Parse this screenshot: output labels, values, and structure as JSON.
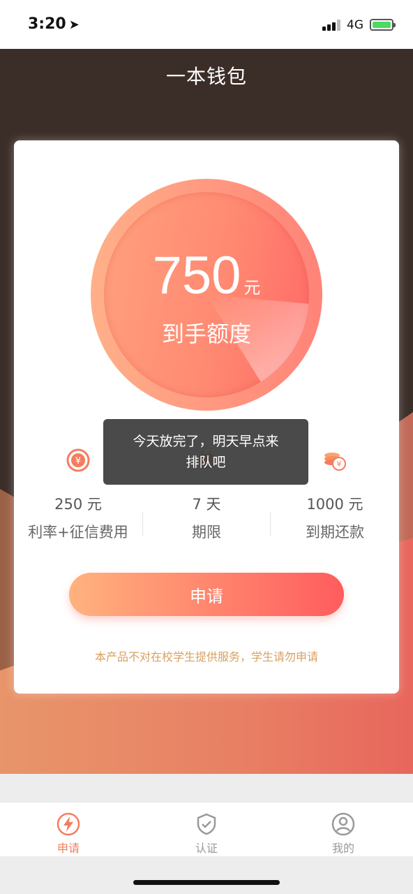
{
  "status": {
    "time": "3:20",
    "location_icon": "location-arrow-icon",
    "network": "4G"
  },
  "app": {
    "title": "一本钱包"
  },
  "gauge": {
    "amount": "750",
    "unit": "元",
    "label": "到手额度"
  },
  "stats": [
    {
      "icon": "yuan-coin-icon",
      "value": "250 元",
      "label": "利率+征信费用"
    },
    {
      "icon": "calendar-icon",
      "value": "7 天",
      "label": "期限"
    },
    {
      "icon": "coin-stack-icon",
      "value": "1000 元",
      "label": "到期还款"
    }
  ],
  "apply_button": {
    "label": "申请"
  },
  "notice": "本产品不对在校学生提供服务，学生请勿申请",
  "toast": {
    "line1": "今天放完了，明天早点来",
    "line2": "排队吧"
  },
  "tabs": [
    {
      "label": "申请",
      "icon": "lightning-icon",
      "active": true
    },
    {
      "label": "认证",
      "icon": "shield-check-icon",
      "active": false
    },
    {
      "label": "我的",
      "icon": "user-icon",
      "active": false
    }
  ],
  "colors": {
    "accent": "#f47d5e",
    "hero_bg": "#3b2d28",
    "notice": "#d8a060"
  }
}
